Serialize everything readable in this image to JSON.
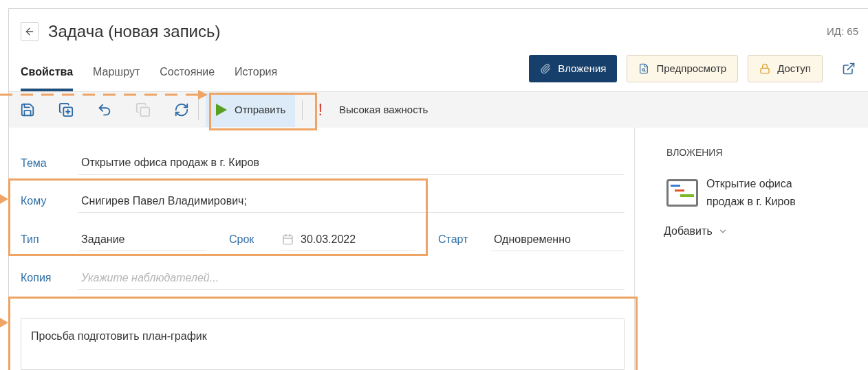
{
  "header": {
    "title": "Задача (новая запись)",
    "id_label": "ИД: 65"
  },
  "tabs": [
    {
      "label": "Свойства",
      "selected": true
    },
    {
      "label": "Маршрут",
      "selected": false
    },
    {
      "label": "Состояние",
      "selected": false
    },
    {
      "label": "История",
      "selected": false
    }
  ],
  "actions": [
    {
      "label": "Вложения",
      "kind": "primary"
    },
    {
      "label": "Предпросмотр",
      "kind": "preview"
    },
    {
      "label": "Доступ",
      "kind": "access"
    }
  ],
  "toolbar": {
    "tools": [
      {
        "kind": "save",
        "disabled": false
      },
      {
        "kind": "save-as",
        "disabled": false
      },
      {
        "kind": "undo",
        "disabled": false
      },
      {
        "kind": "copy",
        "disabled": true
      },
      {
        "kind": "refresh",
        "disabled": false
      }
    ],
    "send_button": "Отправить",
    "importance_mark": "!",
    "importance_label": "Высокая важность"
  },
  "form": {
    "subject": {
      "label": "Тема",
      "value": "Открытие офиса продаж в г. Киров"
    },
    "to": {
      "label": "Кому",
      "value": "Снигирев Павел Владимирович;"
    },
    "type": {
      "label": "Тип",
      "value": "Задание"
    },
    "due": {
      "label": "Срок",
      "value": "30.03.2022"
    },
    "start": {
      "label": "Старт",
      "value": "Одновременно"
    },
    "copy": {
      "label": "Копия",
      "placeholder": "Укажите наблюдателей..."
    },
    "body": "Просьба подготовить план-график"
  },
  "attachments": {
    "heading": "ВЛОЖЕНИЯ",
    "items": [
      {
        "name": "Открытие офиса продаж в г. Киров"
      }
    ],
    "add_label": "Добавить"
  }
}
